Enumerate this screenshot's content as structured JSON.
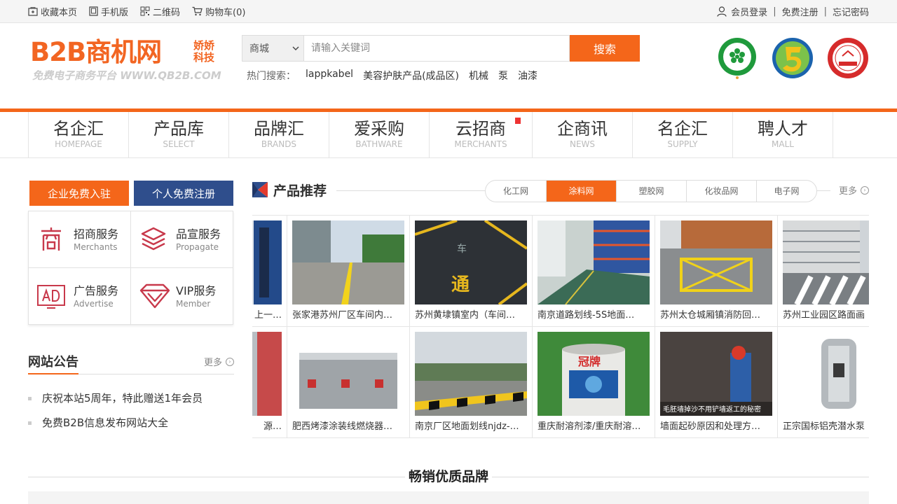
{
  "topbar": {
    "favorite": "收藏本页",
    "mobile": "手机版",
    "qrcode": "二维码",
    "cart": "购物车(0)",
    "login": "会员登录",
    "register": "免费注册",
    "forgot": "忘记密码",
    "sep": "|"
  },
  "logo": {
    "main": "B2B商机网",
    "side": "娇娇科技",
    "sub": "免费电子商务平台 WWW.QB2B.COM"
  },
  "search": {
    "category": "商城",
    "placeholder": "请输入关键词",
    "button": "搜索",
    "hot_label": "热门搜索：",
    "hot": [
      "lappkabel",
      "美容护肤产品(成品区)",
      "机械",
      "泵",
      "油漆"
    ]
  },
  "nav": [
    {
      "cn": "名企汇",
      "en": "HOMEPAGE"
    },
    {
      "cn": "产品库",
      "en": "SELECT"
    },
    {
      "cn": "品牌汇",
      "en": "BRANDS"
    },
    {
      "cn": "爱采购",
      "en": "BATHWARE"
    },
    {
      "cn": "云招商",
      "en": "MERCHANTS"
    },
    {
      "cn": "企商讯",
      "en": "NEWS"
    },
    {
      "cn": "名企汇",
      "en": "SUPPLY"
    },
    {
      "cn": "聘人才",
      "en": "MALL"
    }
  ],
  "sidebar": {
    "join_button": "企业免费入驻",
    "register_button": "个人免费注册",
    "services": [
      {
        "title": "招商服务",
        "en": "Merchants",
        "icon": "shang-icon"
      },
      {
        "title": "品宣服务",
        "en": "Propagate",
        "icon": "layers-icon"
      },
      {
        "title": "广告服务",
        "en": "Advertise",
        "icon": "ad-icon"
      },
      {
        "title": "VIP服务",
        "en": "Member",
        "icon": "diamond-icon"
      }
    ],
    "notice_title": "网站公告",
    "notice_more": "更多",
    "notices": [
      "庆祝本站5周年，特此赠送1年会员",
      "免费B2B信息发布网站大全"
    ]
  },
  "products": {
    "title": "产品推荐",
    "more": "更多",
    "tabs": [
      "化工网",
      "涂料网",
      "塑胶网",
      "化妆品网",
      "电子网"
    ],
    "active_tab": 1,
    "row1": [
      "上一…",
      "张家港苏州厂区车间内…",
      "苏州黄埭镇室内（车间…",
      "南京道路划线-5S地面…",
      "苏州太仓城厢镇消防回…",
      "苏州工业园区路面画"
    ],
    "row2": [
      "源…",
      "肥西烤漆涂装线燃烧器…",
      "南京厂区地面划线njdz-…",
      "重庆耐溶剂漆/重庆耐溶…",
      "墙面起砂原因和处理方…",
      "正宗国标铝壳潜水泵"
    ],
    "img_caption": "毛胚墙掉沙不用铲墙返工的秘密"
  },
  "brands": {
    "title": "畅销优质品牌"
  },
  "colors": {
    "accent": "#f4661a",
    "navy": "#2f4e8c",
    "svc_icon": "#c8394b"
  }
}
